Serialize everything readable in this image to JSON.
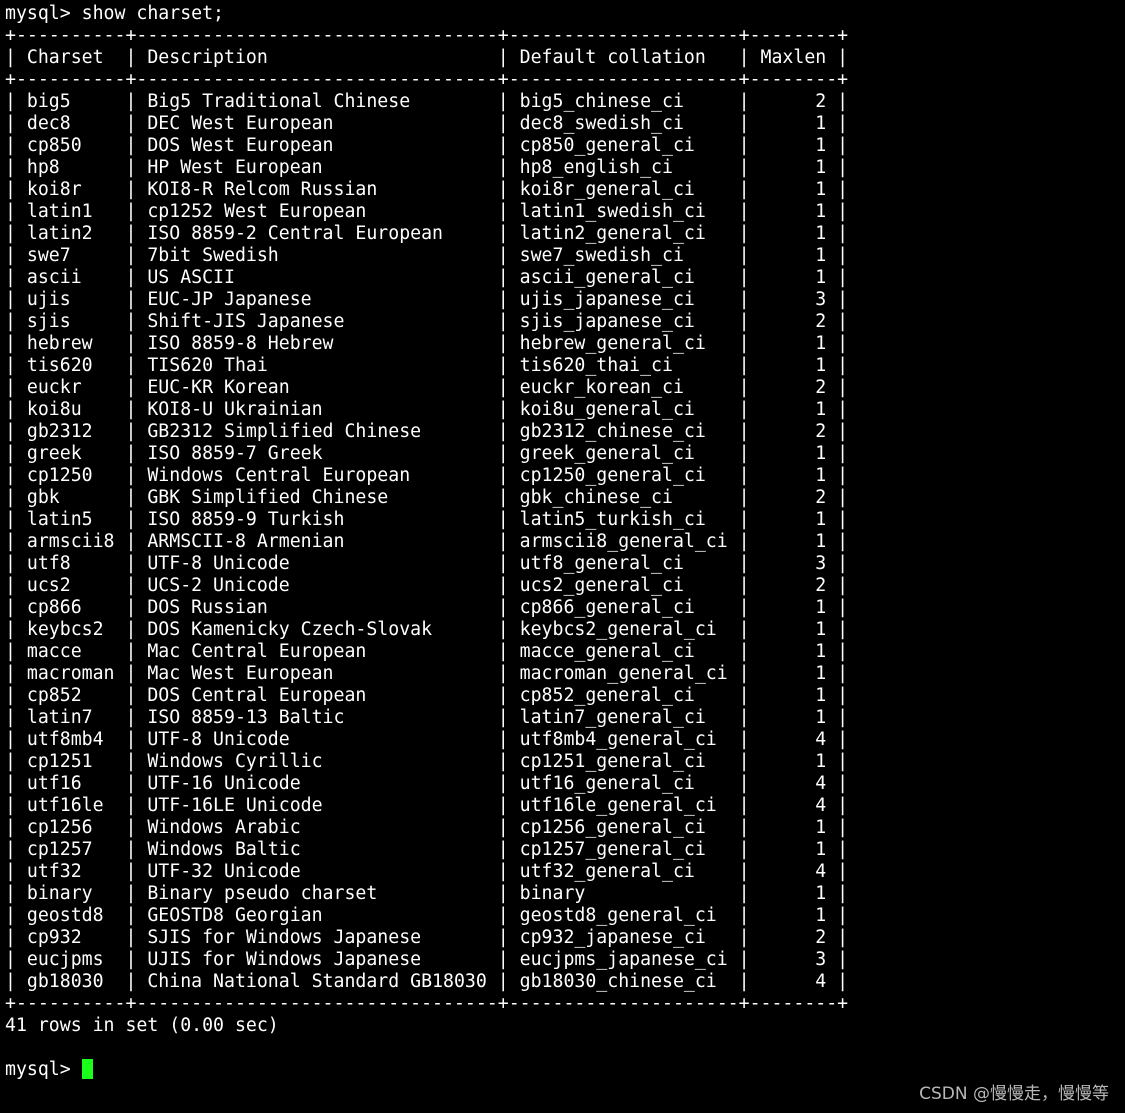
{
  "terminal": {
    "command_line": "mysql> show charset;",
    "table": {
      "columns": [
        "Charset",
        "Description",
        "Default collation",
        "Maxlen"
      ],
      "rows": [
        [
          "big5",
          "Big5 Traditional Chinese",
          "big5_chinese_ci",
          2
        ],
        [
          "dec8",
          "DEC West European",
          "dec8_swedish_ci",
          1
        ],
        [
          "cp850",
          "DOS West European",
          "cp850_general_ci",
          1
        ],
        [
          "hp8",
          "HP West European",
          "hp8_english_ci",
          1
        ],
        [
          "koi8r",
          "KOI8-R Relcom Russian",
          "koi8r_general_ci",
          1
        ],
        [
          "latin1",
          "cp1252 West European",
          "latin1_swedish_ci",
          1
        ],
        [
          "latin2",
          "ISO 8859-2 Central European",
          "latin2_general_ci",
          1
        ],
        [
          "swe7",
          "7bit Swedish",
          "swe7_swedish_ci",
          1
        ],
        [
          "ascii",
          "US ASCII",
          "ascii_general_ci",
          1
        ],
        [
          "ujis",
          "EUC-JP Japanese",
          "ujis_japanese_ci",
          3
        ],
        [
          "sjis",
          "Shift-JIS Japanese",
          "sjis_japanese_ci",
          2
        ],
        [
          "hebrew",
          "ISO 8859-8 Hebrew",
          "hebrew_general_ci",
          1
        ],
        [
          "tis620",
          "TIS620 Thai",
          "tis620_thai_ci",
          1
        ],
        [
          "euckr",
          "EUC-KR Korean",
          "euckr_korean_ci",
          2
        ],
        [
          "koi8u",
          "KOI8-U Ukrainian",
          "koi8u_general_ci",
          1
        ],
        [
          "gb2312",
          "GB2312 Simplified Chinese",
          "gb2312_chinese_ci",
          2
        ],
        [
          "greek",
          "ISO 8859-7 Greek",
          "greek_general_ci",
          1
        ],
        [
          "cp1250",
          "Windows Central European",
          "cp1250_general_ci",
          1
        ],
        [
          "gbk",
          "GBK Simplified Chinese",
          "gbk_chinese_ci",
          2
        ],
        [
          "latin5",
          "ISO 8859-9 Turkish",
          "latin5_turkish_ci",
          1
        ],
        [
          "armscii8",
          "ARMSCII-8 Armenian",
          "armscii8_general_ci",
          1
        ],
        [
          "utf8",
          "UTF-8 Unicode",
          "utf8_general_ci",
          3
        ],
        [
          "ucs2",
          "UCS-2 Unicode",
          "ucs2_general_ci",
          2
        ],
        [
          "cp866",
          "DOS Russian",
          "cp866_general_ci",
          1
        ],
        [
          "keybcs2",
          "DOS Kamenicky Czech-Slovak",
          "keybcs2_general_ci",
          1
        ],
        [
          "macce",
          "Mac Central European",
          "macce_general_ci",
          1
        ],
        [
          "macroman",
          "Mac West European",
          "macroman_general_ci",
          1
        ],
        [
          "cp852",
          "DOS Central European",
          "cp852_general_ci",
          1
        ],
        [
          "latin7",
          "ISO 8859-13 Baltic",
          "latin7_general_ci",
          1
        ],
        [
          "utf8mb4",
          "UTF-8 Unicode",
          "utf8mb4_general_ci",
          4
        ],
        [
          "cp1251",
          "Windows Cyrillic",
          "cp1251_general_ci",
          1
        ],
        [
          "utf16",
          "UTF-16 Unicode",
          "utf16_general_ci",
          4
        ],
        [
          "utf16le",
          "UTF-16LE Unicode",
          "utf16le_general_ci",
          4
        ],
        [
          "cp1256",
          "Windows Arabic",
          "cp1256_general_ci",
          1
        ],
        [
          "cp1257",
          "Windows Baltic",
          "cp1257_general_ci",
          1
        ],
        [
          "utf32",
          "UTF-32 Unicode",
          "utf32_general_ci",
          4
        ],
        [
          "binary",
          "Binary pseudo charset",
          "binary",
          1
        ],
        [
          "geostd8",
          "GEOSTD8 Georgian",
          "geostd8_general_ci",
          1
        ],
        [
          "cp932",
          "SJIS for Windows Japanese",
          "cp932_japanese_ci",
          2
        ],
        [
          "eucjpms",
          "UJIS for Windows Japanese",
          "eucjpms_japanese_ci",
          3
        ],
        [
          "gb18030",
          "China National Standard GB18030",
          "gb18030_chinese_ci",
          4
        ]
      ]
    },
    "result_summary": "41 rows in set (0.00 sec)",
    "prompt": "mysql>",
    "cursor_color": "#1aff1a"
  },
  "watermark": "CSDN @慢慢走，慢慢等"
}
